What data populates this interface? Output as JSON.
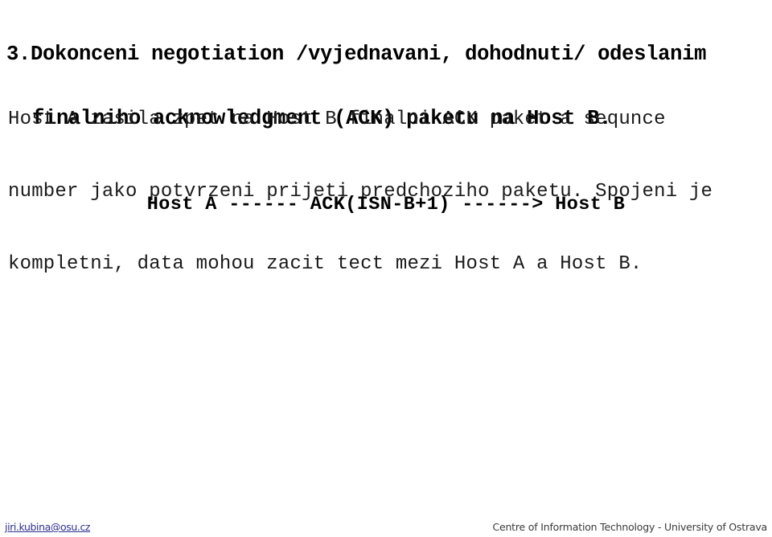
{
  "slide": {
    "background_color": "#ffffff",
    "heading": {
      "line_1": "3.Dokonceni negotiation /vyjednavani, dohodnuti/ odeslanim",
      "line_2": "finalniho acknowledgment (ACK) paketu na Host B.",
      "color": "#000000"
    },
    "body": {
      "line_1": "Host A zasila zpet na Host B finalni ACK paket a sequnce",
      "line_2": "number jako potvrzeni prijeti predchoziho paketu. Spojeni je",
      "line_3": "kompletni, data mohou zacit tect mezi Host A a Host B.",
      "color": "#1a1a1a"
    },
    "diagram": {
      "line": "Host A ------ ACK(ISN-B+1) ------> Host B",
      "color": "#000000"
    },
    "footer": {
      "email": "jiri.kubina@osu.cz",
      "email_color": "#2f2f8f",
      "organization": "Centre of Information Technology - University of Ostrava",
      "organization_color": "#3a3a3a"
    }
  }
}
